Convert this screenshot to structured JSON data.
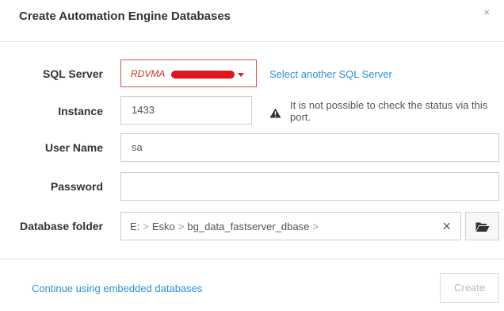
{
  "dialog": {
    "title": "Create Automation Engine Databases",
    "close_glyph": "×"
  },
  "form": {
    "sql_server": {
      "label": "SQL Server",
      "value": "RDVMA",
      "link": "Select another SQL Server"
    },
    "instance": {
      "label": "Instance",
      "value": "1433",
      "warning": "It is not possible to check the status via this port."
    },
    "user_name": {
      "label": "User Name",
      "value": "sa"
    },
    "password": {
      "label": "Password",
      "value": ""
    },
    "database_folder": {
      "label": "Database folder",
      "path": [
        "E:",
        "Esko",
        "bg_data_fastserver_dbase"
      ],
      "separator": ">",
      "clear_glyph": "×"
    }
  },
  "footer": {
    "embedded_link": "Continue using embedded databases",
    "create_label": "Create"
  },
  "icons": {
    "warning": "warning-triangle-icon",
    "folder": "folder-open-icon",
    "caret": "chevron-down-icon"
  },
  "colors": {
    "link": "#2d8fd8",
    "error": "#c9302c",
    "disabled": "#b8b8b8"
  }
}
